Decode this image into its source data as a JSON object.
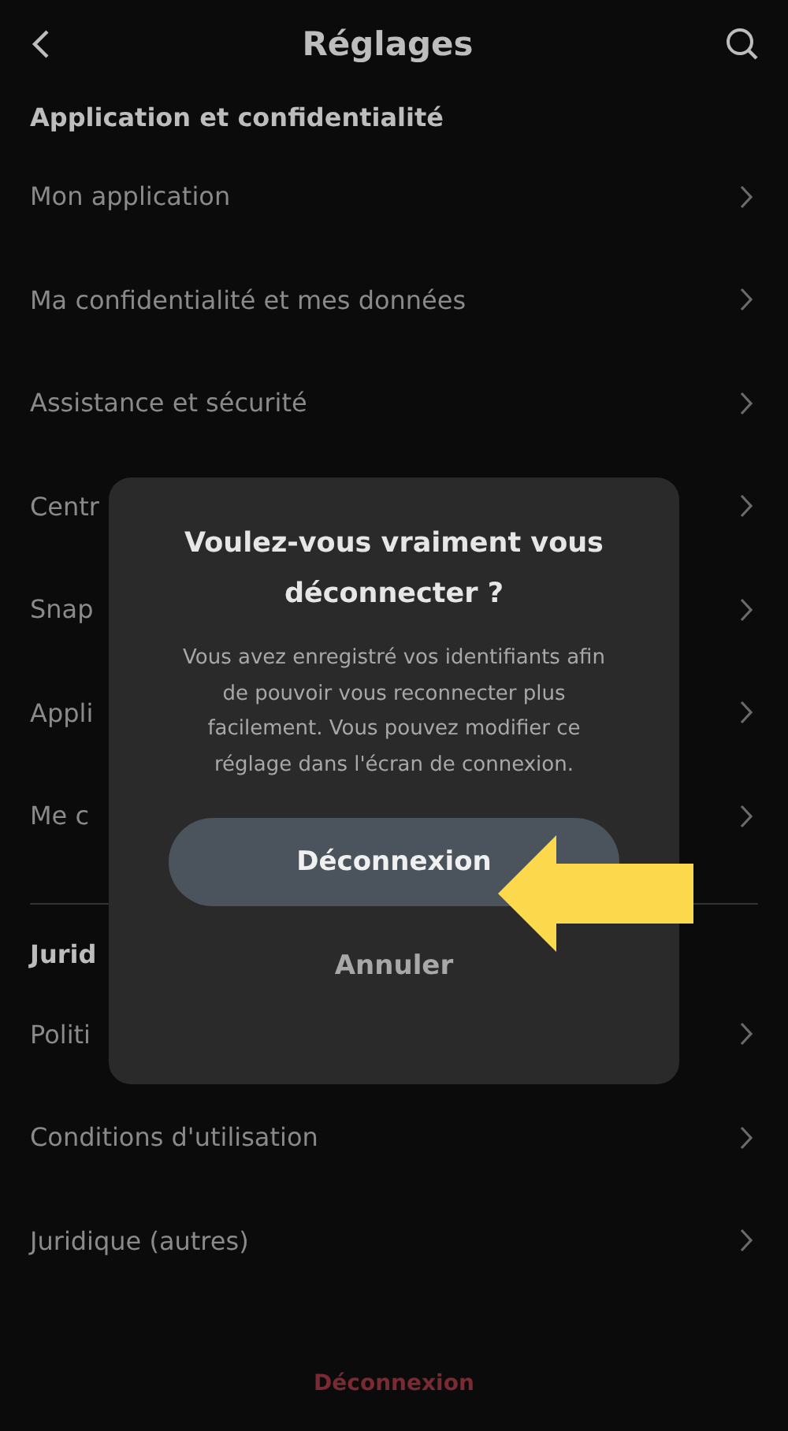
{
  "header": {
    "title": "Réglages"
  },
  "sections": [
    {
      "title": "Application et confidentialité",
      "items": [
        {
          "label": "Mon application"
        },
        {
          "label": "Ma confidentialité et mes données"
        },
        {
          "label": "Assistance et sécurité"
        },
        {
          "label": "Centr"
        },
        {
          "label": "Snap"
        },
        {
          "label": "Appli"
        },
        {
          "label": "Me c"
        }
      ]
    },
    {
      "title": "Jurid",
      "items": [
        {
          "label": "Politi"
        },
        {
          "label": "Conditions d'utilisation"
        },
        {
          "label": "Juridique (autres)"
        }
      ]
    }
  ],
  "logout_link": "Déconnexion",
  "dialog": {
    "title": "Voulez-vous vraiment vous déconnecter ?",
    "message": "Vous avez enregistré vos identifiants afin de pouvoir vous reconnecter plus facilement. Vous pouvez modifier ce réglage dans l'écran de connexion.",
    "confirm": "Déconnexion",
    "cancel": "Annuler"
  }
}
